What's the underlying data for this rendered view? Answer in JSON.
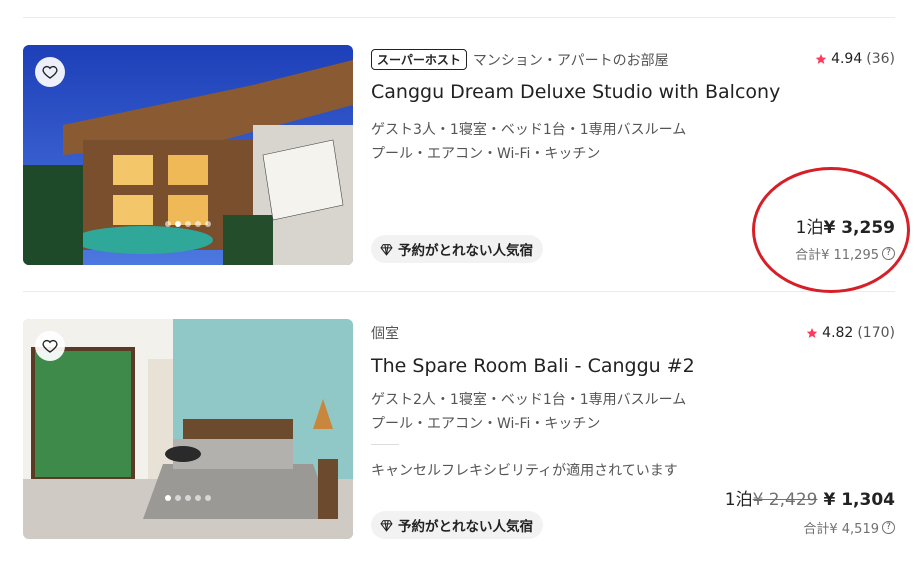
{
  "listings": [
    {
      "superhost_label": "スーパーホスト",
      "room_type": "マンション・アパートのお部屋",
      "rating": "4.94",
      "review_count": "(36)",
      "title": "Canggu Dream Deluxe Studio with Balcony",
      "details": "ゲスト3人・1寝室・ベッド1台・1専用バスルーム",
      "amenities": "プール・エアコン・Wi-Fi・キッチン",
      "badge": "予約がとれない人気宿",
      "price_prefix": "1泊",
      "price": "¥ 3,259",
      "total": "合計¥ 11,295",
      "photo_count": 5,
      "active_photo": 1
    },
    {
      "room_type": "個室",
      "rating": "4.82",
      "review_count": "(170)",
      "title": "The Spare Room Bali - Canggu #2",
      "details": "ゲスト2人・1寝室・ベッド1台・1専用バスルーム",
      "amenities": "プール・エアコン・Wi-Fi・キッチン",
      "cancellation": "キャンセルフレキシビリティが適用されています",
      "badge": "予約がとれない人気宿",
      "price_prefix": "1泊",
      "old_price": "¥ 2,429",
      "price": "¥ 1,304",
      "total": "合計¥ 4,519",
      "photo_count": 5,
      "active_photo": 0
    }
  ],
  "colors": {
    "star": "#ff385c",
    "annotation": "#d61f26",
    "badge_bg": "#f2f2f2"
  },
  "icons": {
    "wishlist": "heart-icon",
    "rating": "star-icon",
    "badge": "diamond-icon",
    "help": "question-icon"
  }
}
